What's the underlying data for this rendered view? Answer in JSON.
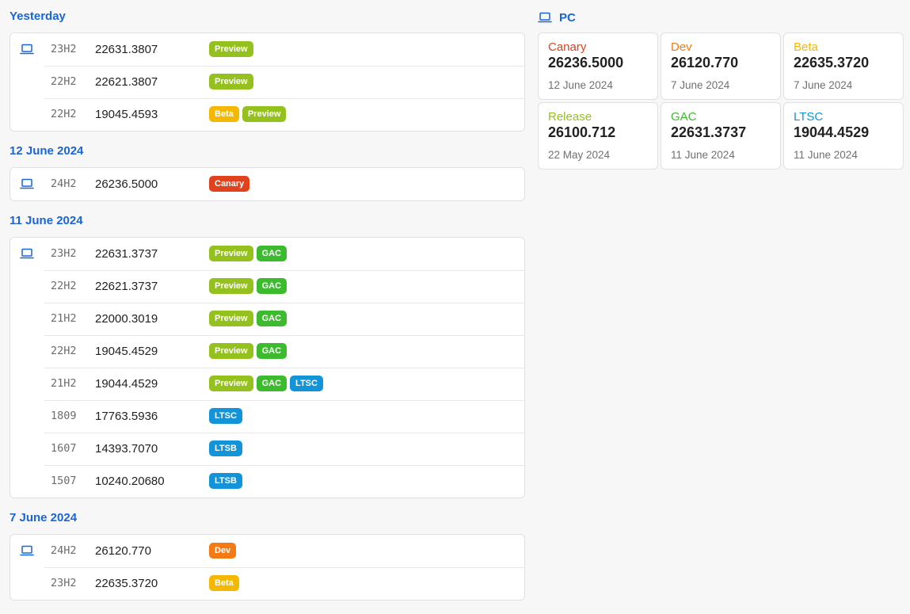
{
  "colors": {
    "heading": "#1a66d6",
    "Preview": "#95c11f",
    "GAC": "#3dbb2e",
    "LTSC": "#1393d8",
    "LTSB": "#1393d8",
    "Beta": "#f5b800",
    "Canary": "#e0421e",
    "Dev": "#f47b14"
  },
  "icons": {
    "device": "laptop-icon"
  },
  "history": [
    {
      "heading": "Yesterday",
      "rows": [
        {
          "version": "23H2",
          "build": "22631.3807",
          "badges": [
            "Preview"
          ]
        },
        {
          "version": "22H2",
          "build": "22621.3807",
          "badges": [
            "Preview"
          ]
        },
        {
          "version": "22H2",
          "build": "19045.4593",
          "badges": [
            "Beta",
            "Preview"
          ]
        }
      ]
    },
    {
      "heading": "12 June 2024",
      "rows": [
        {
          "version": "24H2",
          "build": "26236.5000",
          "badges": [
            "Canary"
          ]
        }
      ]
    },
    {
      "heading": "11 June 2024",
      "rows": [
        {
          "version": "23H2",
          "build": "22631.3737",
          "badges": [
            "Preview",
            "GAC"
          ]
        },
        {
          "version": "22H2",
          "build": "22621.3737",
          "badges": [
            "Preview",
            "GAC"
          ]
        },
        {
          "version": "21H2",
          "build": "22000.3019",
          "badges": [
            "Preview",
            "GAC"
          ]
        },
        {
          "version": "22H2",
          "build": "19045.4529",
          "badges": [
            "Preview",
            "GAC"
          ]
        },
        {
          "version": "21H2",
          "build": "19044.4529",
          "badges": [
            "Preview",
            "GAC",
            "LTSC"
          ]
        },
        {
          "version": "1809",
          "build": "17763.5936",
          "badges": [
            "LTSC"
          ]
        },
        {
          "version": "1607",
          "build": "14393.7070",
          "badges": [
            "LTSB"
          ]
        },
        {
          "version": "1507",
          "build": "10240.20680",
          "badges": [
            "LTSB"
          ]
        }
      ]
    },
    {
      "heading": "7 June 2024",
      "rows": [
        {
          "version": "24H2",
          "build": "26120.770",
          "badges": [
            "Dev"
          ]
        },
        {
          "version": "23H2",
          "build": "22635.3720",
          "badges": [
            "Beta"
          ]
        }
      ]
    }
  ],
  "pc": {
    "title": "PC",
    "channels": [
      {
        "name": "Canary",
        "build": "26236.5000",
        "date": "12 June 2024",
        "color": "#e0421e"
      },
      {
        "name": "Dev",
        "build": "26120.770",
        "date": "7 June 2024",
        "color": "#f47b14"
      },
      {
        "name": "Beta",
        "build": "22635.3720",
        "date": "7 June 2024",
        "color": "#f5b800"
      },
      {
        "name": "Release",
        "build": "26100.712",
        "date": "22 May 2024",
        "color": "#95c11f"
      },
      {
        "name": "GAC",
        "build": "22631.3737",
        "date": "11 June 2024",
        "color": "#3dbb2e"
      },
      {
        "name": "LTSC",
        "build": "19044.4529",
        "date": "11 June 2024",
        "color": "#1393d8"
      }
    ]
  }
}
